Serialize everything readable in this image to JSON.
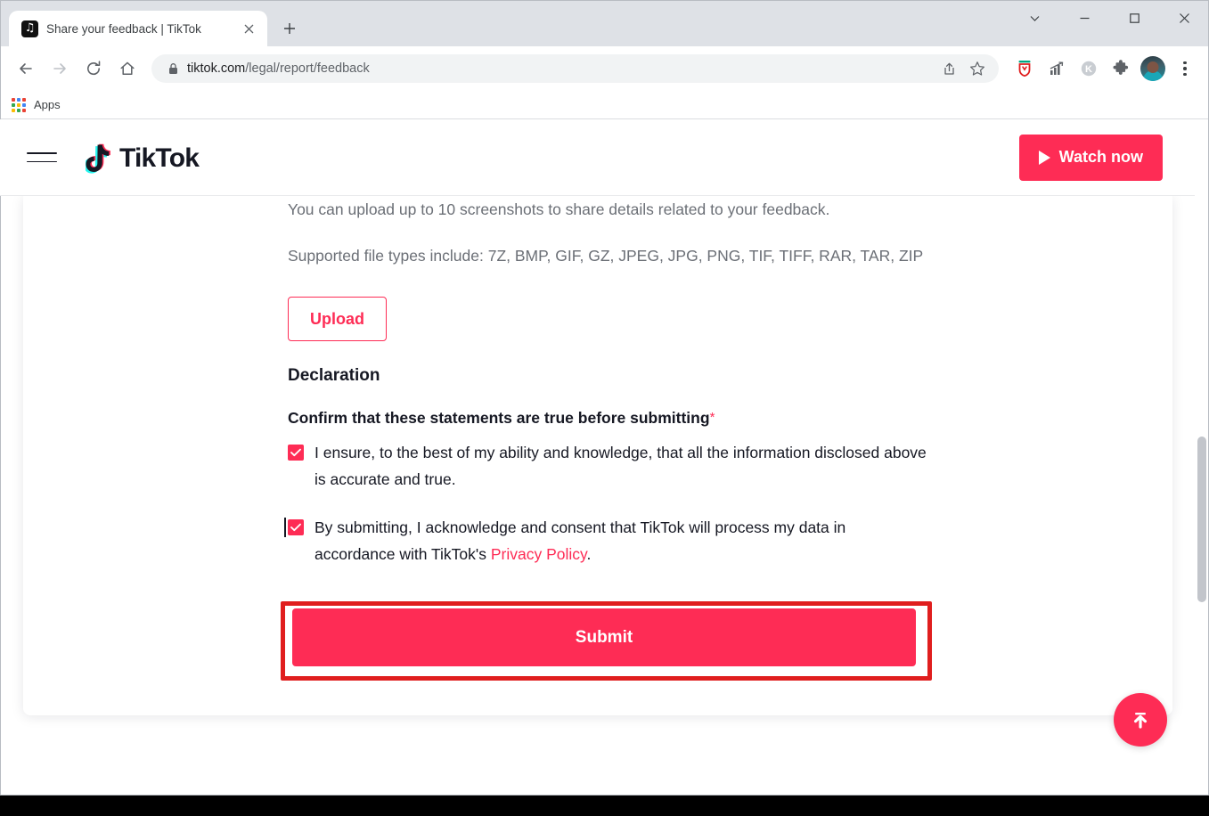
{
  "browser": {
    "tab": {
      "title": "Share your feedback | TikTok",
      "favicon_name": "tiktok-favicon",
      "close_label": "✕"
    },
    "new_tab_label": "+",
    "window_controls": {
      "expand_label": "chevron-down-icon",
      "minimize_label": "minimize-icon",
      "maximize_label": "maximize-icon",
      "close_label": "close-icon"
    },
    "nav": {
      "back": "back-arrow",
      "forward": "forward-arrow",
      "reload": "reload-icon",
      "home": "home-icon"
    },
    "omnibox": {
      "url_domain": "tiktok.com",
      "url_path": "/legal/report/feedback",
      "lock": "lock-icon",
      "share": "share-icon",
      "bookmark": "star-icon"
    },
    "extensions": [
      {
        "name": "ublock-shield-icon",
        "color": "#e01e1e"
      },
      {
        "name": "analytics-chart-icon",
        "color": "#5f6368"
      },
      {
        "name": "kee-circle-icon",
        "color": "#9aa0a6"
      },
      {
        "name": "puzzle-extensions-icon",
        "color": "#5f6368"
      }
    ],
    "profile_label": "avatar",
    "menu_label": "kebab-menu-icon",
    "bookmarks": {
      "apps_label": "Apps",
      "apps_icon": "apps-grid-icon"
    }
  },
  "site": {
    "brand": {
      "name": "TikTok",
      "logo_name": "tiktok-note-logo",
      "cyan": "#25f4ee",
      "pink": "#fe2c55",
      "ink": "#161823"
    },
    "menu_label": "hamburger-menu",
    "watch_now": {
      "label": "Watch now",
      "icon": "play-icon",
      "color": "#fe2c55"
    }
  },
  "main": {
    "upload_hint": "You can upload up to 10 screenshots to share details related to your feedback.",
    "supported_types": "Supported file types include: 7Z, BMP, GIF, GZ, JPEG, JPG, PNG, TIF, TIFF, RAR, TAR, ZIP",
    "upload_button": "Upload",
    "declaration_title": "Declaration",
    "confirm_label": "Confirm that these statements are true before submitting",
    "required_marker": "*",
    "checkboxes": [
      {
        "checked": true,
        "text": "I ensure, to the best of my ability and knowledge, that all the information disclosed above is accurate and true."
      },
      {
        "checked": true,
        "text_before": "By submitting, I acknowledge and consent that TikTok will process my data in accordance with TikTok's ",
        "link_text": "Privacy Policy",
        "text_after": "."
      }
    ],
    "submit_button": "Submit",
    "highlight_color": "#e01e1e",
    "scroll_top_label": "scroll-to-top"
  }
}
